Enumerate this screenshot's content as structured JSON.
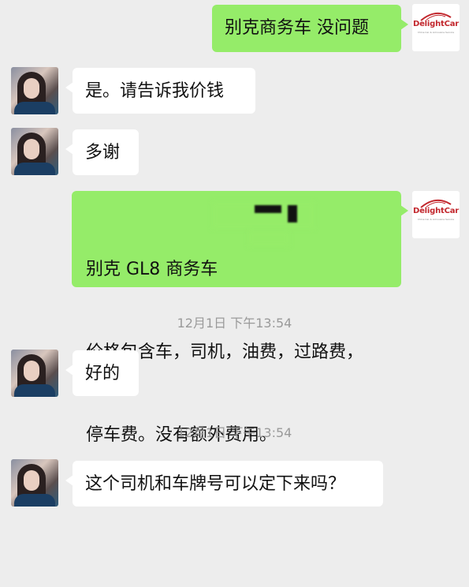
{
  "messages": [
    {
      "side": "me",
      "text": "别克商务车 没问题"
    },
    {
      "side": "them",
      "text": "是。请告诉我价钱"
    },
    {
      "side": "them",
      "text": "多谢"
    },
    {
      "side": "me",
      "line1": "别克 GL8 商务车",
      "line2": "价格包含车，司机，油费，过路费，",
      "line3": "停车费。没有额外费用。"
    },
    {
      "side": "time",
      "text": "12月1日 下午13:54"
    },
    {
      "side": "them",
      "text": "好的"
    },
    {
      "side": "time",
      "text": "12月1日 下午13:54"
    },
    {
      "side": "them",
      "text": "这个司机和车牌号可以定下来吗？"
    }
  ],
  "brand": {
    "name": "DelightCar",
    "tagline": "China Car & Limousine Service",
    "color": "#c2272d"
  },
  "colors": {
    "green_bubble": "#95ec69",
    "background": "#ededed"
  }
}
